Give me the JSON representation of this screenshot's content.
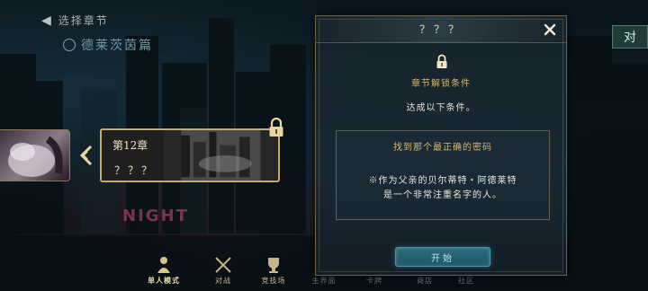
{
  "header": {
    "back_label": "选择章节",
    "chapter_group_name": "德莱茨茵篇"
  },
  "chapters": {
    "current": {
      "number_label": "第12章",
      "title": "？？？"
    }
  },
  "bottom_nav": [
    {
      "id": "single",
      "label": "单人模式",
      "icon": "figure-icon",
      "active": true
    },
    {
      "id": "battle",
      "label": "对战",
      "icon": "crossed-swords-icon",
      "active": false
    },
    {
      "id": "arena",
      "label": "竞技场",
      "icon": "trophy-icon",
      "active": false
    },
    {
      "id": "main",
      "label": "主界面",
      "icon": "home-icon",
      "active": false
    },
    {
      "id": "cards",
      "label": "卡牌",
      "icon": "cards-icon",
      "active": false
    },
    {
      "id": "shop",
      "label": "商店",
      "icon": "shop-icon",
      "active": false
    },
    {
      "id": "social",
      "label": "社区",
      "icon": "people-icon",
      "active": false
    }
  ],
  "edge_tag": "对",
  "modal": {
    "title": "？？？",
    "unlock_heading": "章节解锁条件",
    "unlock_desc": "达成以下条件。",
    "condition_title": "找到那个最正确的密码",
    "condition_note_line1": "※作为父亲的贝尔蒂特・阿德莱特",
    "condition_note_line2": "是一个非常注重名字的人。",
    "start_label": "开始"
  },
  "colors": {
    "gold": "#c7ab6a",
    "heading_gold": "#d8b86a",
    "teal_button": "#2d6e7e"
  }
}
